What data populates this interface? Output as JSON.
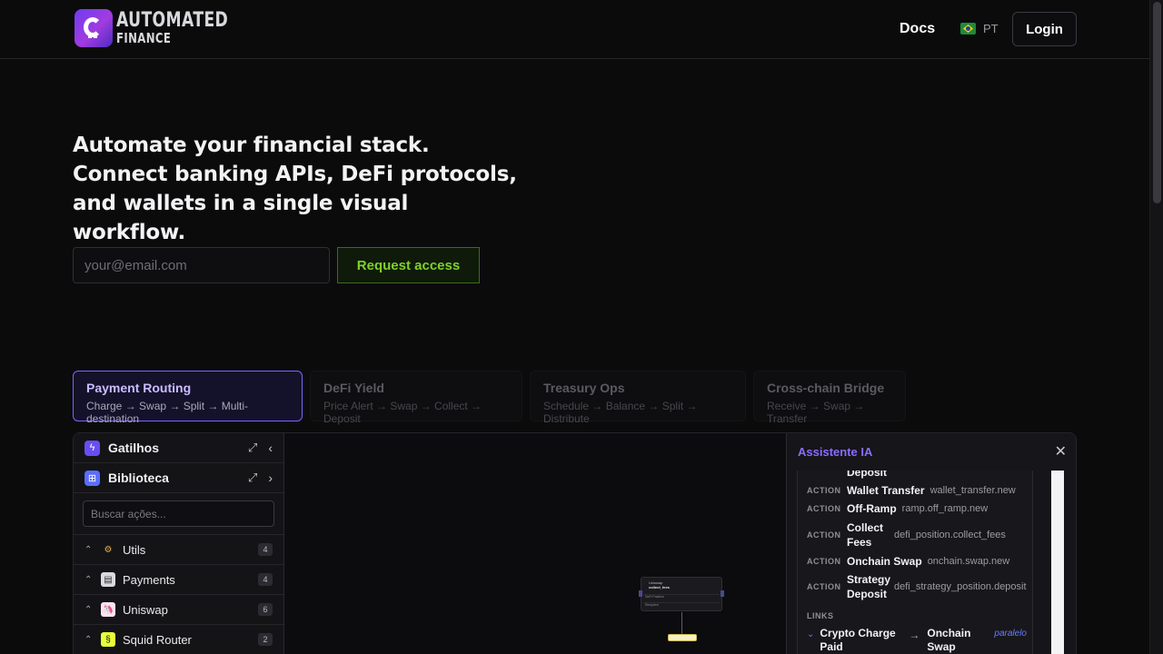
{
  "header": {
    "logo_line1": "AUTOMATED",
    "logo_line2": "FINANCE",
    "docs_label": "Docs",
    "lang_label": "PT",
    "login_label": "Login"
  },
  "hero": {
    "title": "Automate your financial stack. Connect banking APIs, DeFi protocols, and wallets in a single visual workflow.",
    "email_placeholder": "your@email.com",
    "request_label": "Request access"
  },
  "tabs": [
    {
      "title": "Payment Routing",
      "subtitle": "Charge → Swap → Split → Multi-destination",
      "active": true
    },
    {
      "title": "DeFi Yield",
      "subtitle": "Price Alert → Swap → Collect → Deposit",
      "active": false
    },
    {
      "title": "Treasury Ops",
      "subtitle": "Schedule → Balance → Split → Distribute",
      "active": false
    },
    {
      "title": "Cross-chain Bridge",
      "subtitle": "Receive → Swap → Transfer",
      "active": false
    }
  ],
  "sidebar": {
    "triggers_label": "Gatilhos",
    "library_label": "Biblioteca",
    "search_placeholder": "Buscar ações...",
    "categories": [
      {
        "label": "Utils",
        "count": "4"
      },
      {
        "label": "Payments",
        "count": "4"
      },
      {
        "label": "Uniswap",
        "count": "6"
      },
      {
        "label": "Squid Router",
        "count": "2"
      }
    ]
  },
  "canvas": {
    "node_title": "Uniswap",
    "node_subtitle": "collect_fees",
    "node_field1": "DeFi Position",
    "node_field2": "Recipient"
  },
  "assistant": {
    "title": "Assistente IA",
    "partial_label": "Deposit",
    "actions": [
      {
        "tag": "ACTION",
        "name": "Wallet Transfer",
        "code": "wallet_transfer.new"
      },
      {
        "tag": "ACTION",
        "name": "Off-Ramp",
        "code": "ramp.off_ramp.new"
      },
      {
        "tag": "ACTION",
        "name": "Collect Fees",
        "code": "defi_position.collect_fees"
      },
      {
        "tag": "ACTION",
        "name": "Onchain Swap",
        "code": "onchain.swap.new"
      },
      {
        "tag": "ACTION",
        "name": "Strategy Deposit",
        "code": "defi_strategy_position.deposit"
      }
    ],
    "links_label": "LINKS",
    "link": {
      "from": "Crypto Charge Paid",
      "to": "Onchain Swap",
      "mode": "paralelo"
    }
  }
}
